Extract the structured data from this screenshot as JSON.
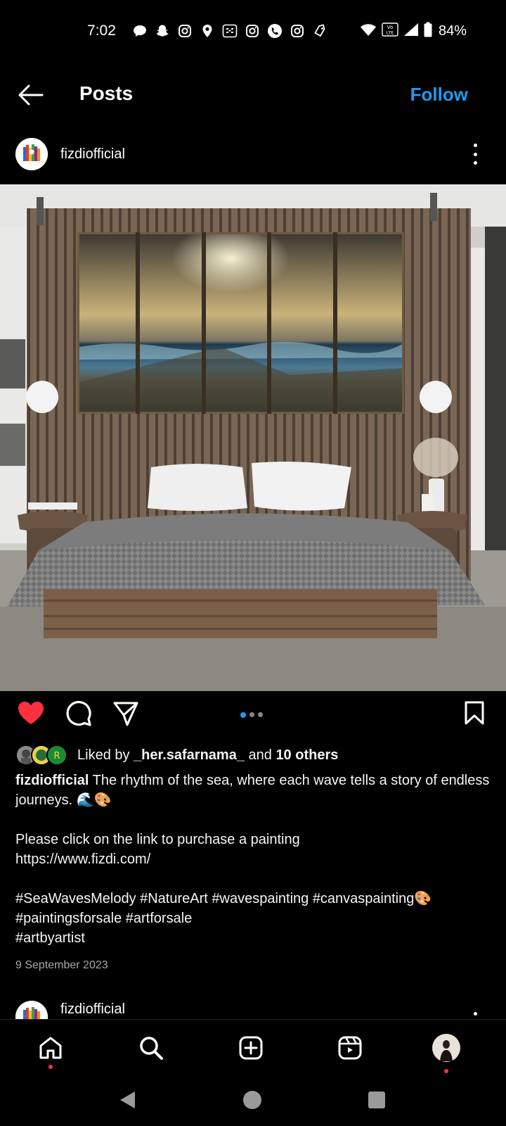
{
  "status_bar": {
    "time": "7:02",
    "battery": "84%",
    "notification_icons": [
      "message-bubble-icon",
      "snapchat-icon",
      "instagram-icon",
      "location-pin-icon",
      "calculator-icon",
      "instagram-icon",
      "viber-icon",
      "instagram-icon",
      "tag-icon"
    ],
    "network": "VoLTE"
  },
  "header": {
    "title": "Posts",
    "follow_label": "Follow"
  },
  "post": {
    "username": "fizdiofficial",
    "likes": {
      "prefix": "Liked by ",
      "first_user": "_her.safarnama_",
      "middle": " and ",
      "others": "10 others"
    },
    "caption": {
      "username": "fizdiofficial",
      "line1": " The rhythm of the sea, where each wave tells a story of endless journeys. 🌊🎨",
      "line2": "Please click on the link to purchase a painting",
      "link": "https://www.fizdi.com/",
      "hashtags1": "#SeaWavesMelody #NatureArt #wavespainting #canvaspainting🎨",
      "hashtags2": "#paintingsforsale #artforsale",
      "hashtags3": "#artbyartist"
    },
    "date": "9 September 2023",
    "carousel": {
      "count": 3,
      "active": 1
    },
    "liked": true
  },
  "next_post": {
    "username": "fizdiofficial"
  },
  "colors": {
    "accent": "#1d9bf0",
    "like": "#ff3040",
    "background": "#000000"
  },
  "bottom_nav": [
    "home-icon",
    "search-icon",
    "create-icon",
    "reels-icon",
    "profile-avatar"
  ]
}
